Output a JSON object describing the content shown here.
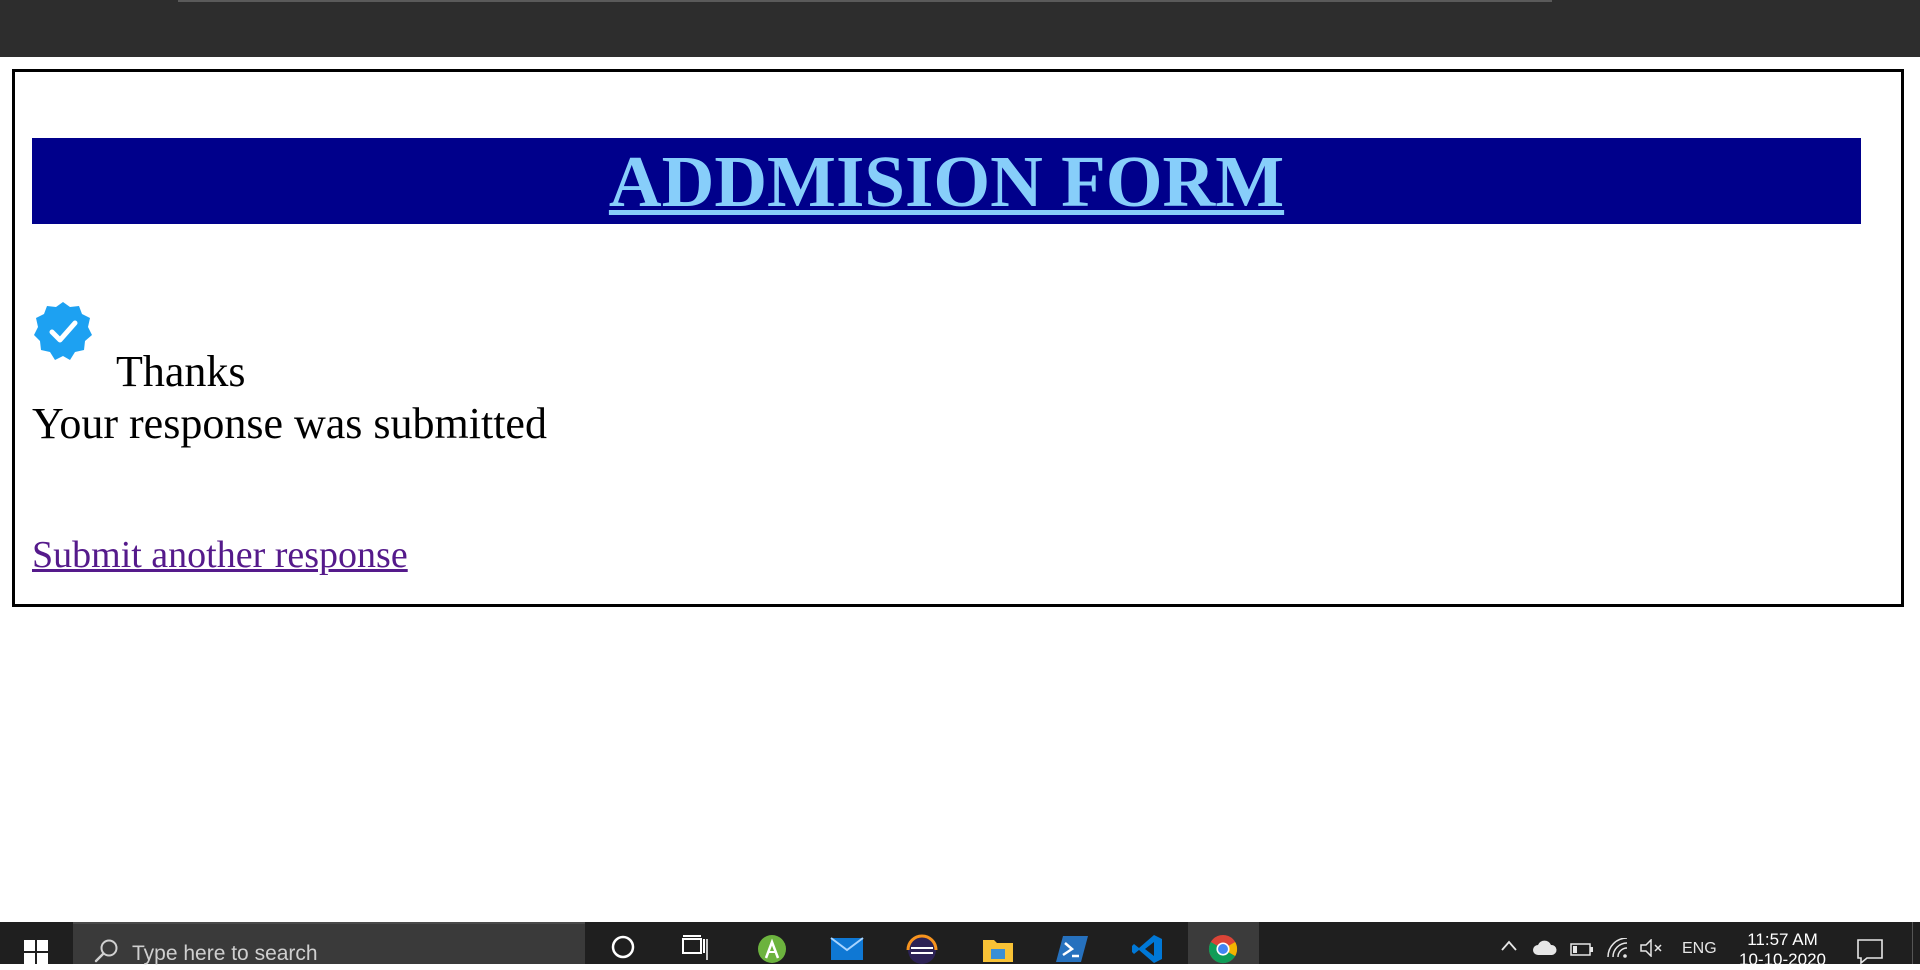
{
  "form": {
    "title": "ADDMISION FORM",
    "thanks": "Thanks",
    "message": "Your response was submitted",
    "another_link": "Submit another response"
  },
  "colors": {
    "banner_bg": "#00008b",
    "title": "#87cefa",
    "check_badge": "#1da1f2",
    "visited_link": "#551a8b"
  },
  "icons": {
    "check": "verified-check-icon",
    "taskbar": [
      "windows-start-icon",
      "search-icon",
      "cortana-icon",
      "task-view-icon",
      "android-studio-icon",
      "mail-icon",
      "eclipse-icon",
      "file-explorer-icon",
      "powershell-icon",
      "vscode-icon",
      "chrome-icon"
    ],
    "tray": [
      "chevron-up-icon",
      "onedrive-icon",
      "battery-icon",
      "wifi-icon",
      "volume-muted-icon",
      "notification-icon"
    ]
  },
  "taskbar": {
    "search_placeholder": "Type here to search",
    "language": "ENG",
    "time": "11:57 AM",
    "date": "10-10-2020"
  }
}
